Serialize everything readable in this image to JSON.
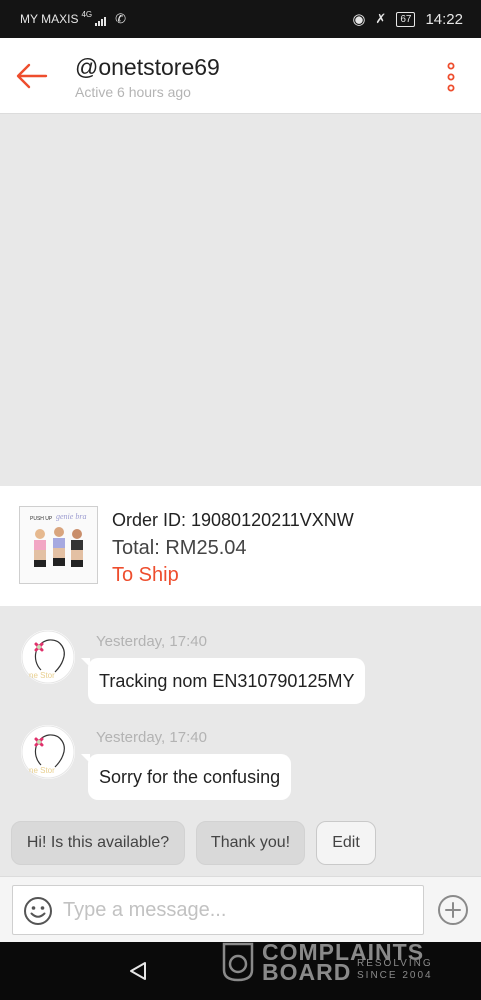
{
  "status_bar": {
    "carrier": "MY MAXIS",
    "network": "4G",
    "battery": "67",
    "time": "14:22"
  },
  "header": {
    "title": "@onetstore69",
    "subtitle": "Active 6 hours ago"
  },
  "order": {
    "thumb_label": "PUSH UP",
    "thumb_brand": "genie bra",
    "order_id": "Order ID: 19080120211VXNW",
    "total": "Total: RM25.04",
    "status": "To Ship"
  },
  "messages": [
    {
      "avatar_text": "ne Stor",
      "timestamp": "Yesterday, 17:40",
      "text": "Tracking nom EN310790125MY"
    },
    {
      "avatar_text": "ne Stor",
      "timestamp": "Yesterday, 17:40",
      "text": "Sorry for the confusing"
    }
  ],
  "quick_replies": [
    "Hi! Is this available?",
    "Thank you!",
    "Edit"
  ],
  "composer": {
    "placeholder": "Type a message..."
  },
  "watermark": {
    "line1": "COMPLAINTS",
    "line2": "BOARD",
    "line3": "RESOLVING",
    "line4": "SINCE 2004"
  },
  "colors": {
    "accent": "#ee4d2d",
    "header_bg": "#ffffff",
    "chat_bg": "#e8e8e8"
  }
}
